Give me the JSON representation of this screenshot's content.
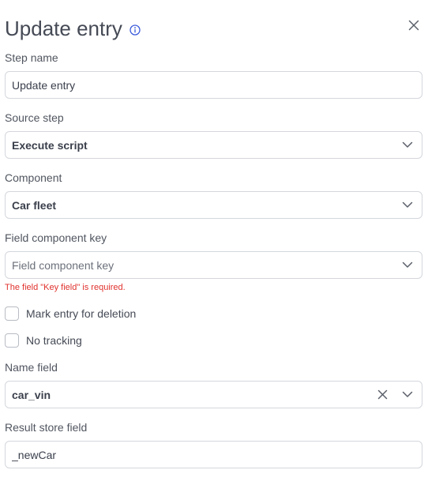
{
  "header": {
    "title": "Update entry"
  },
  "step_name": {
    "label": "Step name",
    "value": "Update entry"
  },
  "source_step": {
    "label": "Source step",
    "value": "Execute script"
  },
  "component": {
    "label": "Component",
    "value": "Car fleet"
  },
  "field_component_key": {
    "label": "Field component key",
    "placeholder": "Field component key",
    "error": "The field \"Key field\" is required."
  },
  "checkboxes": {
    "mark_for_deletion": {
      "label": "Mark entry for deletion",
      "checked": false
    },
    "no_tracking": {
      "label": "No tracking",
      "checked": false
    }
  },
  "name_field": {
    "label": "Name field",
    "value": "car_vin"
  },
  "result_store_field": {
    "label": "Result store field",
    "value": "_newCar"
  },
  "colors": {
    "error": "#e0322d",
    "info_icon": "#3b5bdb",
    "border": "#d4d7dc"
  },
  "icons": [
    "info-icon",
    "close-icon",
    "chevron-down-icon",
    "clear-icon"
  ]
}
